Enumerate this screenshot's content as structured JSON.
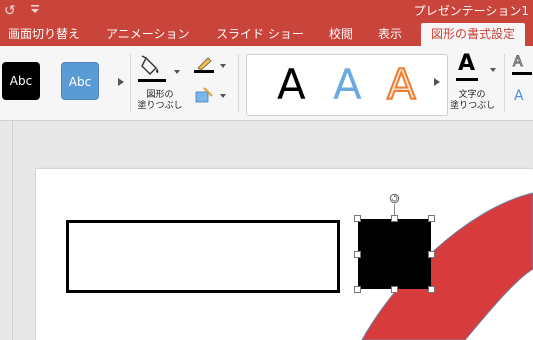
{
  "titlebar": {
    "undo_icon": "undo-icon",
    "title": "プレゼンテーション1"
  },
  "tabs": [
    {
      "label": "画面切り替え",
      "active": false
    },
    {
      "label": "アニメーション",
      "active": false
    },
    {
      "label": "スライド ショー",
      "active": false
    },
    {
      "label": "校閲",
      "active": false
    },
    {
      "label": "表示",
      "active": false
    },
    {
      "label": "図形の書式設定",
      "active": true
    }
  ],
  "ribbon": {
    "shape_styles": [
      {
        "label": "Abc",
        "fill": "#000000",
        "text_color": "#ffffff"
      },
      {
        "label": "Abc",
        "fill": "#5b9bd5",
        "text_color": "#ffffff"
      }
    ],
    "shape_fill": {
      "label_line1": "図形の",
      "label_line2": "塗りつぶし",
      "icon": "paint-bucket-icon"
    },
    "shape_outline": {
      "icon": "pencil-icon"
    },
    "shape_effects": {
      "icon": "effects-icon"
    },
    "wordart_styles": [
      {
        "label": "A",
        "style": "black-fill"
      },
      {
        "label": "A",
        "style": "blue-gradient"
      },
      {
        "label": "A",
        "style": "orange-outline"
      }
    ],
    "text_fill": {
      "label_line1": "文字の",
      "label_line2": "塗りつぶし",
      "icon": "text-fill-icon"
    },
    "text_outline": {
      "icon": "text-outline-icon"
    },
    "text_effects": {
      "icon": "text-effects-icon"
    }
  },
  "colors": {
    "accent": "#c9443a",
    "shape_red": "#d83b3b",
    "style_blue": "#5b9bd5",
    "wordart_orange": "#ed7d31"
  }
}
